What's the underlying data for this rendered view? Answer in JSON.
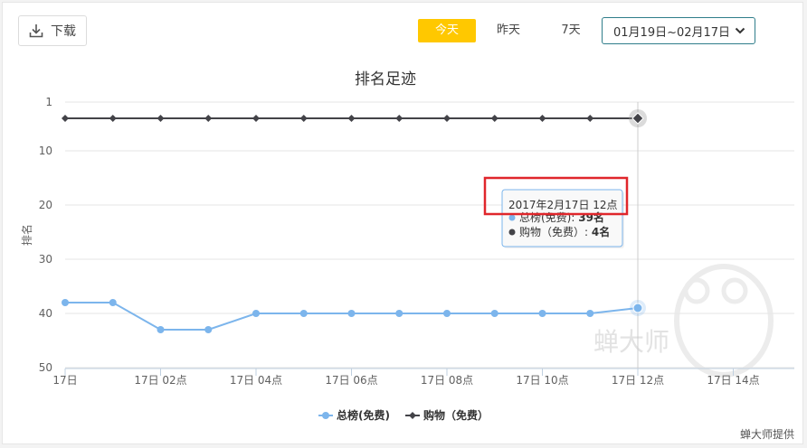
{
  "toolbar": {
    "download_label": "下载",
    "range_tabs": [
      "今天",
      "昨天",
      "7天"
    ],
    "date_range": "01月19日~02月17日"
  },
  "credit": "蝉大师提供",
  "watermark": "蝉大师",
  "colors": {
    "series_total": "#7cb5ec",
    "series_shopping": "#434348",
    "active_tab": "#ffc800",
    "select_border": "#2f7d8a",
    "highlight_box": "#e0262b"
  },
  "chart_data": {
    "type": "line",
    "title": "排名足迹",
    "ylabel": "排名",
    "xlabel": "",
    "y_inverted": true,
    "ylim": [
      1,
      50
    ],
    "yticks": [
      1,
      10,
      20,
      30,
      40,
      50
    ],
    "x_tick_labels": [
      "17日",
      "17日 02点",
      "17日 04点",
      "17日 06点",
      "17日 08点",
      "17日 10点",
      "17日 12点",
      "17日 14点"
    ],
    "x_hours": [
      0,
      1,
      2,
      3,
      4,
      5,
      6,
      7,
      8,
      9,
      10,
      11,
      12
    ],
    "series": [
      {
        "name": "总榜(免费)",
        "marker": "circle",
        "values": [
          38,
          38,
          43,
          43,
          40,
          40,
          40,
          40,
          40,
          40,
          40,
          40,
          39
        ]
      },
      {
        "name": "购物（免费）",
        "marker": "diamond",
        "values": [
          4,
          4,
          4,
          4,
          4,
          4,
          4,
          4,
          4,
          4,
          4,
          4,
          4
        ]
      }
    ],
    "tooltip": {
      "title": "2017年2月17日 12点",
      "rows": [
        {
          "label": "总榜(免费)",
          "value": "39名"
        },
        {
          "label": "购物（免费）",
          "value": "4名"
        }
      ]
    },
    "legend_position": "bottom-center",
    "grid": true
  }
}
